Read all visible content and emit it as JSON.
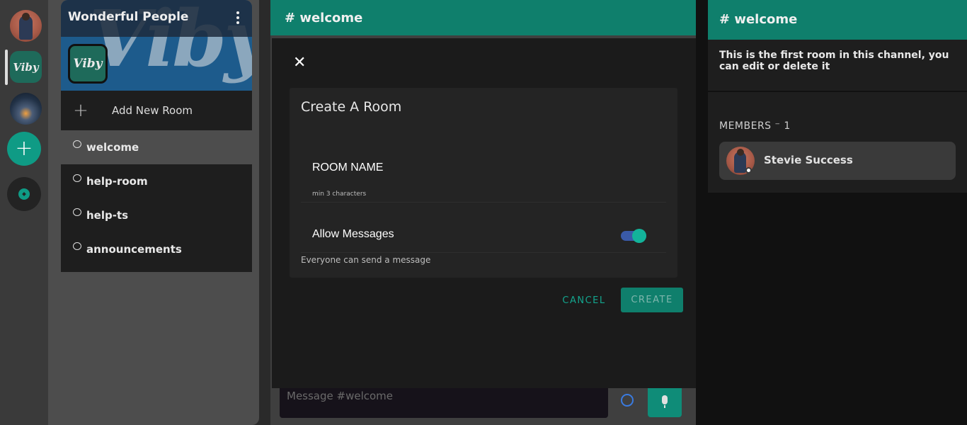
{
  "rail": {
    "viby_label": "Viby",
    "add_symbol": "+"
  },
  "sidebar": {
    "server_name": "Wonderful People",
    "banner_text": "Viby",
    "logo_text": "Viby",
    "add_room_symbol": "+",
    "add_room_label": "Add New Room",
    "rooms": [
      {
        "name": "welcome",
        "active": true
      },
      {
        "name": "help-room",
        "active": false
      },
      {
        "name": "help-ts",
        "active": false
      },
      {
        "name": "announcements",
        "active": false
      }
    ]
  },
  "main": {
    "header": "# welcome",
    "message_placeholder": "Message #welcome"
  },
  "modal": {
    "close_symbol": "✕",
    "title": "Create A Room",
    "room_name_label": "ROOM NAME",
    "room_name_hint": "min 3 characters",
    "allow_messages_label": "Allow Messages",
    "allow_messages_on": true,
    "allow_messages_desc": "Everyone can send a message",
    "cancel_label": "CANCEL",
    "create_label": "CREATE"
  },
  "right": {
    "header": "# welcome",
    "info": "This is the first room in this channel, you can edit or delete it",
    "members_label": "MEMBERS ⁻ 1",
    "members": [
      {
        "name": "Stevie Success",
        "status": "online"
      }
    ]
  },
  "colors": {
    "accent": "#0f7f6c",
    "accent_bright": "#13a58e",
    "toggle_track": "#3a5aa8"
  }
}
